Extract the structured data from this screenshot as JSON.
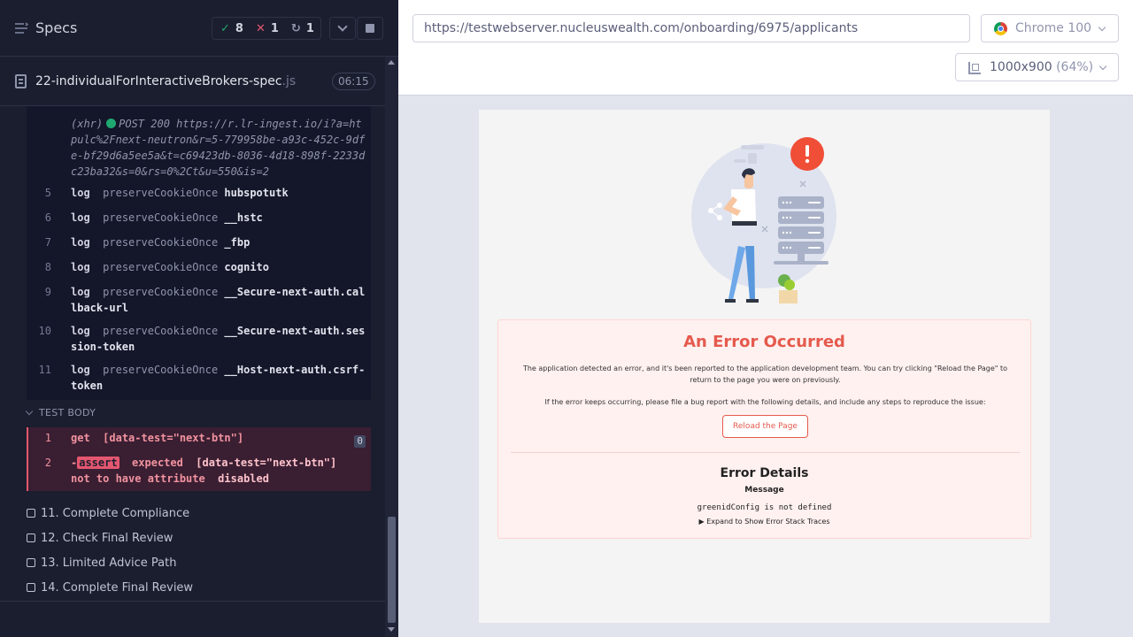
{
  "left_panel": {
    "title": "Specs",
    "stats": {
      "passed": "8",
      "failed": "1",
      "pending": "1"
    },
    "spec_file": {
      "name": "22-individualForInteractiveBrokers-spec",
      "ext": ".js",
      "duration": "06:15"
    },
    "xhr_log": {
      "prefix": "(xhr)",
      "text": "POST 200 https://r.lr-ingest.io/i?a=htpulc%2Fnext-neutron&r=5-779958be-a93c-452c-9dfe-bf29d6a5ee5a&t=c69423db-8036-4d18-898f-2233dc23ba32&s=0&rs=0%2Ct&u=550&is=2"
    },
    "commands": [
      {
        "num": "5",
        "name": "log",
        "method": "preserveCookieOnce",
        "arg": "hubspotutk"
      },
      {
        "num": "6",
        "name": "log",
        "method": "preserveCookieOnce",
        "arg": "__hstc"
      },
      {
        "num": "7",
        "name": "log",
        "method": "preserveCookieOnce",
        "arg": "_fbp"
      },
      {
        "num": "8",
        "name": "log",
        "method": "preserveCookieOnce",
        "arg": "cognito"
      },
      {
        "num": "9",
        "name": "log",
        "method": "preserveCookieOnce",
        "arg": "__Secure-next-auth.callback-url"
      },
      {
        "num": "10",
        "name": "log",
        "method": "preserveCookieOnce",
        "arg": "__Secure-next-auth.session-token"
      },
      {
        "num": "11",
        "name": "log",
        "method": "preserveCookieOnce",
        "arg": "__Host-next-auth.csrf-token"
      }
    ],
    "test_body_label": "TEST BODY",
    "test_body": {
      "get": {
        "num": "1",
        "cmd": "get",
        "selector": "[data-test=\"next-btn\"]",
        "count": "0"
      },
      "assert": {
        "num": "2",
        "dash": "-",
        "badge": "assert",
        "word_expected": "expected",
        "selector": "[data-test=\"next-btn\"]",
        "word_not_to_have": "not to have attribute",
        "attr": "disabled"
      }
    },
    "tests": [
      "11. Complete Compliance",
      "12. Check Final Review",
      "13. Limited Advice Path",
      "14. Complete Final Review"
    ]
  },
  "top_bar": {
    "url": "https://testwebserver.nucleuswealth.com/onboarding/6975/applicants",
    "browser": "Chrome 100",
    "viewport": "1000x900",
    "viewport_scale": "(64%)"
  },
  "error_page": {
    "title": "An Error Occurred",
    "message1": "The application detected an error, and it's been reported to the application development team. You can try clicking \"Reload the Page\" to return to the page you were on previously.",
    "message2": "If the error keeps occurring, please file a bug report with the following details, and include any steps to reproduce the issue:",
    "reload_label": "Reload the Page",
    "details_title": "Error Details",
    "message_label": "Message",
    "message_text": "greenidConfig is not defined",
    "expand_label": "Expand to Show Error Stack Traces"
  },
  "colors": {
    "reporter_bg": "#1b1e2e",
    "pass": "#1fa971",
    "fail": "#e45770",
    "error_accent": "#e55a4d"
  }
}
